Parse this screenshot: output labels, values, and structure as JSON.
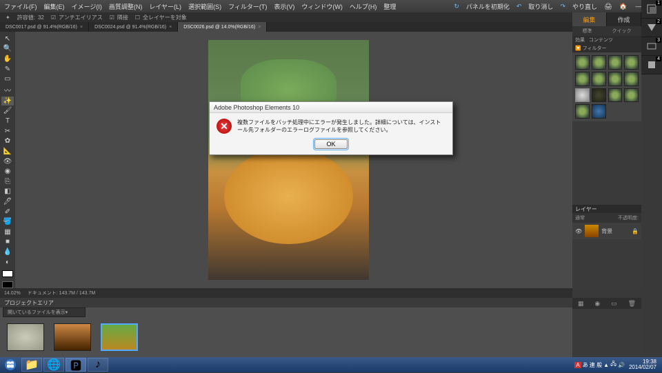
{
  "menu": {
    "file": "ファイル(F)",
    "edit": "編集(E)",
    "image": "イメージ(I)",
    "enhance": "画質調整(N)",
    "layer": "レイヤー(L)",
    "select": "選択範囲(S)",
    "filter": "フィルター(T)",
    "view": "表示(V)",
    "window": "ウィンドウ(W)",
    "help": "ヘルプ(H)",
    "panel_init": "パネルを初期化",
    "undo": "取り消し",
    "redo": "やり直し",
    "arrange": "整理"
  },
  "toolbar": {
    "dropdown": "クイック",
    "antialias": "アンチエイリアス",
    "contiguous": "隣接",
    "all_layers": "全レイヤーを対象"
  },
  "tabs": {
    "t1": "DSC0017.psd @ 91.4%(RGB/16)",
    "t2": "DSC0024.psd @ 91.4%(RGB/16)",
    "t3": "DSC0026.psd @ 14.0%(RGB/16)"
  },
  "panel": {
    "edit": "編集",
    "create": "作成",
    "effects": "効果",
    "content": "コンテンツ",
    "standard": "標準",
    "quick": "クイック",
    "filter_label": "フィルター"
  },
  "layers": {
    "title": "レイヤー",
    "mode": "通常",
    "opacity_label": "不透明度:",
    "name": "背景"
  },
  "status": {
    "zoom": "14.02%",
    "doc": "ドキュメント: 143.7M / 143.7M"
  },
  "projectbin": {
    "title": "プロジェクトエリア",
    "dropdown": "開いているファイルを表示"
  },
  "dialog": {
    "title": "Adobe Photoshop Elements 10",
    "message": "複数ファイルをバッチ処理中にエラーが発生しました。詳細については、インストール先フォルダーのエラーログファイルを参照してください。",
    "ok": "OK"
  },
  "taskbar": {
    "ime": "あ 連 般",
    "time": "19:38",
    "date": "2014/02/07"
  },
  "badges": {
    "b1": "1",
    "b2": "2",
    "b3": "3",
    "b4": "4"
  }
}
